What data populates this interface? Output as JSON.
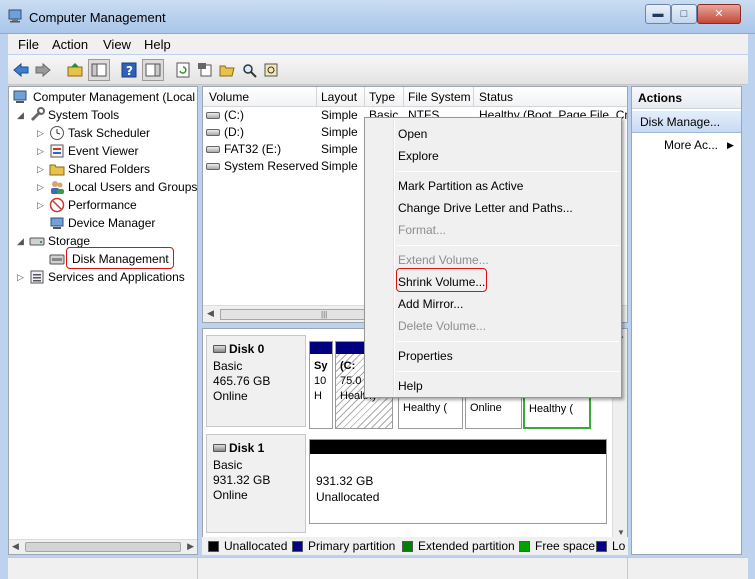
{
  "window": {
    "title": "Computer Management",
    "min_glyph": "▬",
    "max_glyph": "□",
    "close_glyph": "✕"
  },
  "menubar": {
    "items": [
      "File",
      "Action",
      "View",
      "Help"
    ]
  },
  "toolbar": {
    "buttons": [
      "back-icon",
      "forward-icon",
      "up-folder-icon",
      "show-hide-tree-icon",
      "help-icon",
      "show-hide-action-pane-icon",
      "refresh-icon",
      "properties-icon",
      "open-folder-icon",
      "search-disk-icon",
      "properties-sheet-icon"
    ]
  },
  "tree": {
    "root": "Computer Management (Local",
    "system_tools": "System Tools",
    "task_scheduler": "Task Scheduler",
    "event_viewer": "Event Viewer",
    "shared_folders": "Shared Folders",
    "local_users": "Local Users and Groups",
    "performance": "Performance",
    "device_manager": "Device Manager",
    "storage": "Storage",
    "disk_management": "Disk Management",
    "services": "Services and Applications"
  },
  "volumes": {
    "columns": [
      "Volume",
      "Layout",
      "Type",
      "File System",
      "Status"
    ],
    "rows": [
      {
        "volume": "(C:)",
        "layout": "Simple",
        "type": "Basic",
        "fs": "NTFS",
        "status": "Healthy (Boot, Page File, Cra"
      },
      {
        "volume": "(D:)",
        "layout": "Simple",
        "type": "",
        "fs": "",
        "status": ""
      },
      {
        "volume": "FAT32 (E:)",
        "layout": "Simple",
        "type": "",
        "fs": "",
        "status": ""
      },
      {
        "volume": "System Reserved",
        "layout": "Simple",
        "type": "",
        "fs": "",
        "status": ""
      }
    ]
  },
  "disks": [
    {
      "name": "Disk 0",
      "type": "Basic",
      "size": "465.76 GB",
      "state": "Online"
    },
    {
      "name": "Disk 1",
      "type": "Basic",
      "size": "931.32 GB",
      "state": "Online"
    }
  ],
  "disk0_parts": {
    "sys_l1": "Sy",
    "sys_l2": "10",
    "sys_l3": "H",
    "c_l1": "(C:",
    "c_l2": "75.0",
    "c_l3": "Healthy",
    "p3_l3": "Healthy (",
    "p4_l3": "Online",
    "p5_l3": "Healthy ("
  },
  "disk1_part": {
    "size": "931.32 GB",
    "label": "Unallocated"
  },
  "legend": [
    {
      "label": "Unallocated",
      "color": "#000000"
    },
    {
      "label": "Primary partition",
      "color": "#00007f"
    },
    {
      "label": "Extended partition",
      "color": "#008000"
    },
    {
      "label": "Free space",
      "color": "#00a000"
    },
    {
      "label": "Lo",
      "color": "#000080"
    }
  ],
  "actions": {
    "header": "Actions",
    "group": "Disk Manage...",
    "more": "More Ac...",
    "more_arrow": "▶"
  },
  "context_menu": {
    "open": "Open",
    "explore": "Explore",
    "mark_active": "Mark Partition as Active",
    "change_letter": "Change Drive Letter and Paths...",
    "format": "Format...",
    "extend": "Extend Volume...",
    "shrink": "Shrink Volume...",
    "add_mirror": "Add Mirror...",
    "delete": "Delete Volume...",
    "properties": "Properties",
    "help": "Help"
  },
  "colors": {
    "primary": "#00007f",
    "extended": "#008000",
    "highlight": "#e01010"
  }
}
